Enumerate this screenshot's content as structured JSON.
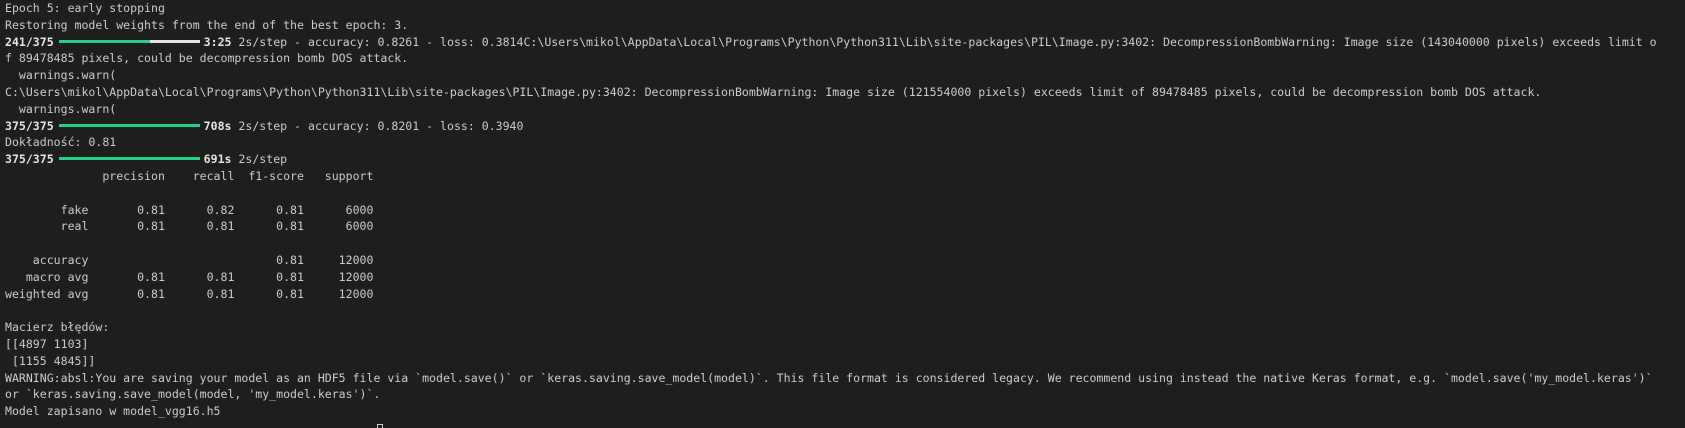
{
  "colors": {
    "background": "#1e1e1e",
    "text": "#cccccc",
    "progress_fill": "#23d18b",
    "progress_remaining": "#e5e5e5"
  },
  "lines": {
    "l01": "Epoch 5: early stopping",
    "l02": "Restoring model weights from the end of the best epoch: 3.",
    "l03_steps": "241/375",
    "l03_eta": "3:25",
    "l03_text": " 2s/step - accuracy: 0.8261 - loss: 0.3814C:\\Users\\mikol\\AppData\\Local\\Programs\\Python\\Python311\\Lib\\site-packages\\PIL\\Image.py:3402: DecompressionBombWarning: Image size (143040000 pixels) exceeds limit o",
    "l04": "f 89478485 pixels, could be decompression bomb DOS attack.",
    "l05": "  warnings.warn(",
    "l06": "C:\\Users\\mikol\\AppData\\Local\\Programs\\Python\\Python311\\Lib\\site-packages\\PIL\\Image.py:3402: DecompressionBombWarning: Image size (121554000 pixels) exceeds limit of 89478485 pixels, could be decompression bomb DOS attack.",
    "l07": "  warnings.warn(",
    "l08_steps": "375/375",
    "l08_time": "708s",
    "l08_text": " 2s/step - accuracy: 0.8201 - loss: 0.3940",
    "l09": "Dokładność: 0.81",
    "l10_steps": "375/375",
    "l10_time": "691s",
    "l10_text": " 2s/step",
    "l11": "              precision    recall  f1-score   support",
    "l12": "",
    "l13": "        fake       0.81      0.82      0.81      6000",
    "l14": "        real       0.81      0.81      0.81      6000",
    "l15": "",
    "l16": "    accuracy                           0.81     12000",
    "l17": "   macro avg       0.81      0.81      0.81     12000",
    "l18": "weighted avg       0.81      0.81      0.81     12000",
    "l19": "",
    "l20": "Macierz błędów:",
    "l21": "[[4897 1103]",
    "l22": " [1155 4845]]",
    "l23": "WARNING:absl:You are saving your model as an HDF5 file via `model.save()` or `keras.saving.save_model(model)`. This file format is considered legacy. We recommend using instead the native Keras format, e.g. `model.save('my_model.keras')`",
    "l24": "or `keras.saving.save_model(model, 'my_model.keras')`.",
    "l25": "Model zapisano w model_vgg16.h5"
  },
  "progress": {
    "epoch_partial": {
      "current": 241,
      "total": 375,
      "fraction": 0.6427
    },
    "evaluation": {
      "current": 375,
      "total": 375,
      "fraction": 1.0
    },
    "prediction": {
      "current": 375,
      "total": 375,
      "fraction": 1.0
    }
  }
}
